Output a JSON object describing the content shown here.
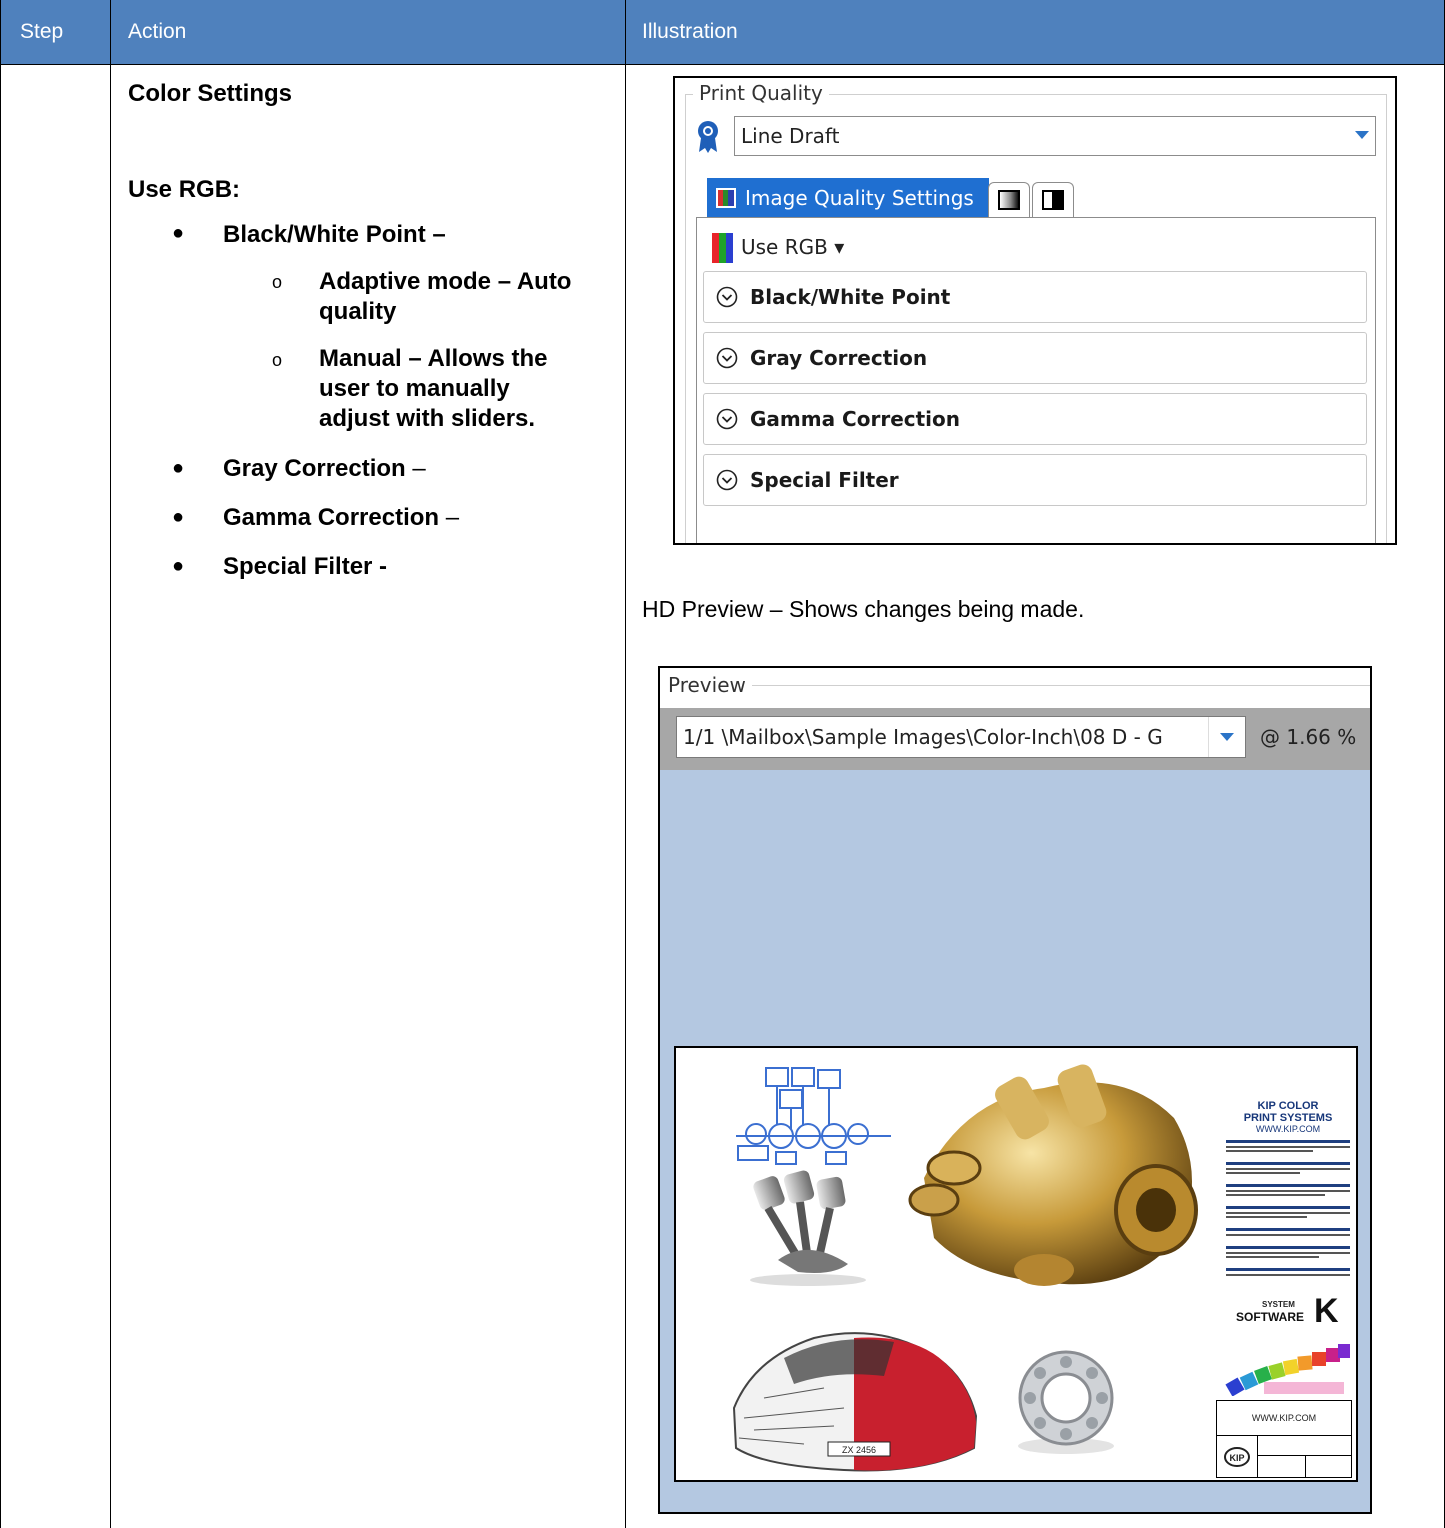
{
  "table": {
    "headers": {
      "step": "Step",
      "action": "Action",
      "illustration": "Illustration"
    },
    "header_color": "#4f81bd"
  },
  "action": {
    "heading": "Color Settings",
    "subheading": "Use RGB:",
    "items": [
      {
        "label": "Black/White Point –"
      },
      {
        "label": "Gray Correction",
        "suffix": " –"
      },
      {
        "label": "Gamma Correction",
        "suffix": " –"
      },
      {
        "label": "Special Filter -"
      }
    ],
    "sub_items": [
      {
        "line1": "Adaptive mode – Auto",
        "line2": "quality"
      },
      {
        "line1": "Manual – Allows the",
        "line2": "user to manually",
        "line3": "adjust with sliders."
      }
    ]
  },
  "print_quality": {
    "group_label": "Print Quality",
    "selected": "Line Draft",
    "active_tab": "Image Quality Settings",
    "color_mode": "Use RGB",
    "sections": [
      "Black/White Point",
      "Gray Correction",
      "Gamma Correction",
      "Special Filter"
    ],
    "accent": "#1f6fd1"
  },
  "hd_caption": "HD Preview – Shows changes being made.",
  "preview": {
    "group_label": "Preview",
    "file": "1/1   \\Mailbox\\Sample Images\\Color-Inch\\08 D - G",
    "zoom": "@ 1.66 %",
    "area_color": "#b4c8e1",
    "sheet": {
      "brand_line1": "KIP COLOR",
      "brand_line2": "PRINT SYSTEMS",
      "url": "WWW.KIP.COM",
      "logo_text_top": "SYSTEM",
      "logo_text_bottom": "SOFTWARE",
      "logo_letter": "K",
      "footer_url": "WWW.KIP.COM",
      "plate": "ZX 2456"
    }
  }
}
